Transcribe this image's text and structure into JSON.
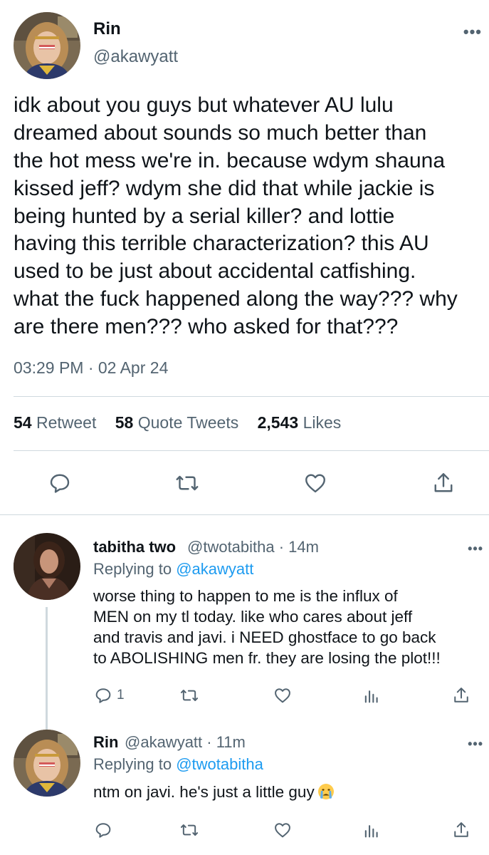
{
  "main_tweet": {
    "display_name": "Rin",
    "handle": "@akawyatt",
    "text_lines": [
      "idk about you guys but whatever AU lulu",
      "dreamed about sounds so much better than",
      "the hot mess we're in. because wdym shauna",
      "kissed jeff? wdym she did that while jackie is",
      "being hunted by a serial killer? and lottie",
      "having this terrible characterization? this AU",
      "used to be just about accidental catfishing.",
      "what the fuck happened along the way??? why",
      "are there men??? who asked for that???"
    ],
    "timestamp": "03:29 PM · 02 Apr 24",
    "stats": {
      "retweets_count": "54",
      "retweets_label": "Retweet",
      "quotes_count": "58",
      "quotes_label": "Quote Tweets",
      "likes_count": "2,543",
      "likes_label": "Likes"
    },
    "more_label": "•••"
  },
  "replies": [
    {
      "display_name": "tabitha two",
      "meta": "@twotabitha · 14m",
      "replying_prefix": "Replying to",
      "replying_to": "@akawyatt",
      "text_lines": [
        "worse thing to happen to me is the influx of",
        "MEN on my tl today. like who cares about jeff",
        "and travis and javi. i NEED ghostface to go back",
        "to ABOLISHING men fr. they are losing the plot!!!"
      ],
      "reply_count": "1",
      "more_label": "•••"
    },
    {
      "display_name": "Rin",
      "meta": "@akawyatt · 11m",
      "replying_prefix": "Replying to",
      "replying_to": "@twotabitha",
      "text": "ntm on javi. he's just a little guy",
      "emoji": "crying-face",
      "more_label": "•••"
    }
  ],
  "colors": {
    "text": "#0f1419",
    "secondary": "#536471",
    "link": "#1d9bf0",
    "divider": "#cfd9de"
  },
  "icons": [
    "reply-icon",
    "retweet-icon",
    "like-icon",
    "share-icon",
    "views-icon",
    "more-icon"
  ]
}
